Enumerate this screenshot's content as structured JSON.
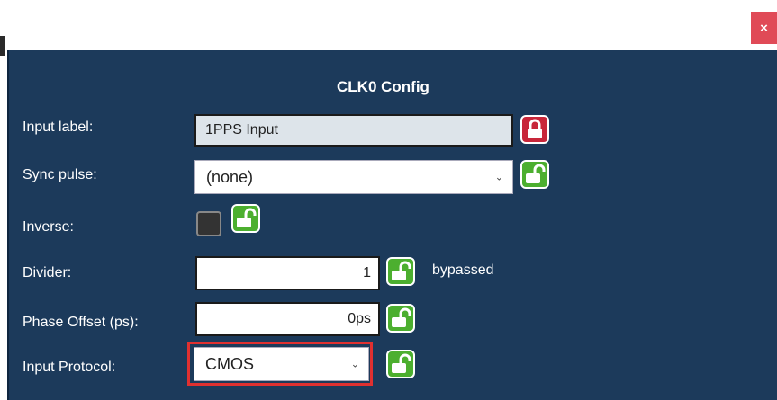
{
  "window": {
    "close_label": "×"
  },
  "config": {
    "title": "CLK0 Config",
    "rows": {
      "input_label": {
        "label": "Input label:",
        "value": "1PPS Input"
      },
      "sync_pulse": {
        "label": "Sync pulse:",
        "value": "(none)"
      },
      "inverse": {
        "label": "Inverse:"
      },
      "divider": {
        "label": "Divider:",
        "value": "1",
        "note": "bypassed"
      },
      "phase_offset": {
        "label": "Phase Offset (ps):",
        "value": "0ps"
      },
      "input_protocol": {
        "label": "Input Protocol:",
        "value": "CMOS"
      }
    }
  },
  "icons": {
    "locked": "lock-closed-icon",
    "unlocked": "lock-open-icon",
    "dropdown": "chevron-down-icon"
  },
  "colors": {
    "panel_bg": "#1c3a5b",
    "unlocked": "#4caf2f",
    "locked": "#c8263a",
    "highlight": "#e03030"
  }
}
